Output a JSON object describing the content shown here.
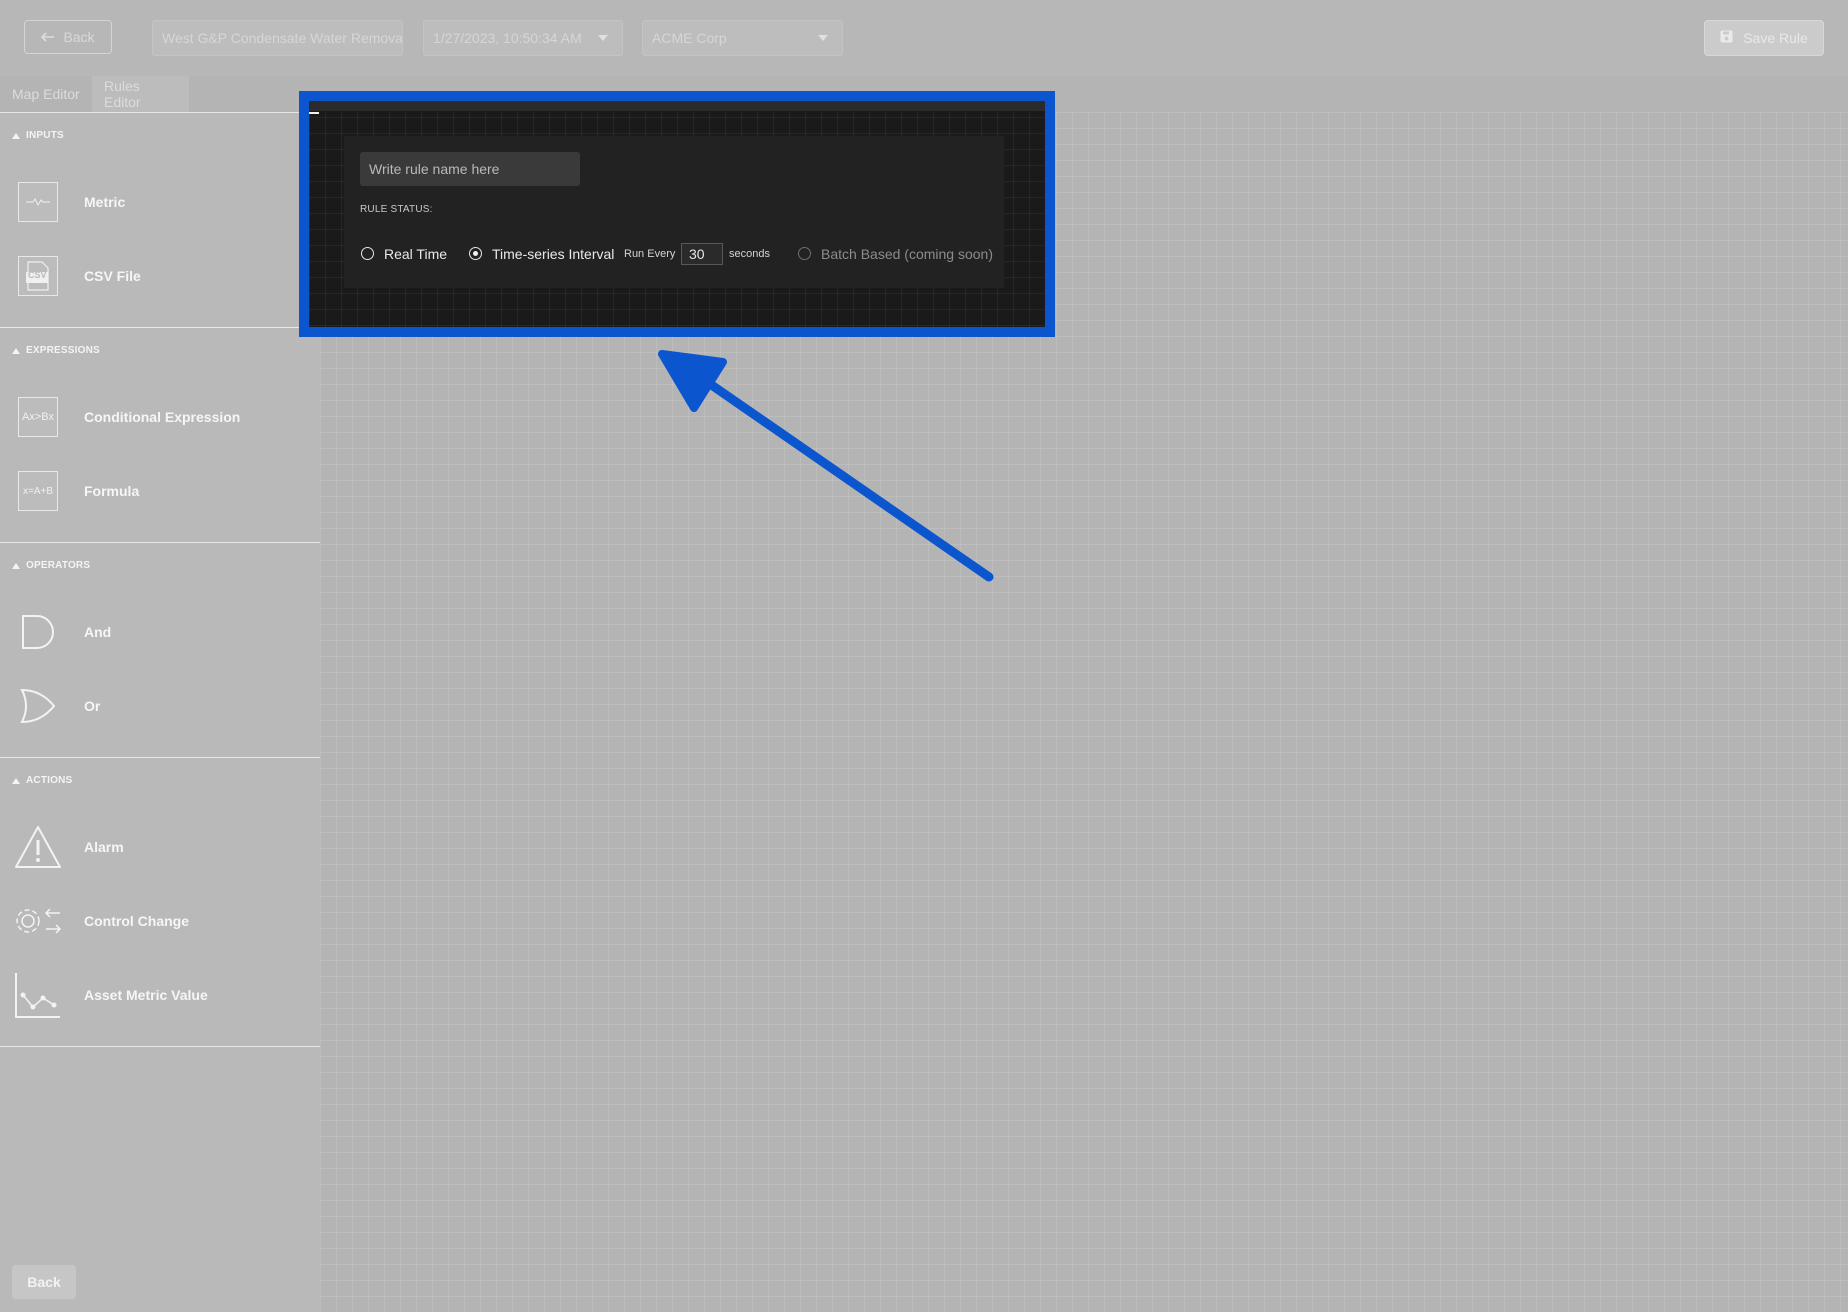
{
  "topbar": {
    "back_label": "Back",
    "asset_name": "West G&P Condensate Water Remova",
    "datetime": "1/27/2023, 10:50:34 AM",
    "company": "ACME Corp",
    "save_label": "Save Rule"
  },
  "tabs": [
    {
      "label": "Map Editor"
    },
    {
      "label": "Rules Editor"
    }
  ],
  "sidebar": {
    "sections": [
      {
        "title": "INPUTS",
        "items": [
          {
            "label": "Metric",
            "icon": "metric-icon"
          },
          {
            "label": "CSV File",
            "icon": "csv-file-icon"
          }
        ]
      },
      {
        "title": "EXPRESSIONS",
        "items": [
          {
            "label": "Conditional Expression",
            "icon": "conditional-expression-icon",
            "icon_text": "Ax>Bx"
          },
          {
            "label": "Formula",
            "icon": "formula-icon",
            "icon_text": "x=A+B"
          }
        ]
      },
      {
        "title": "OPERATORS",
        "items": [
          {
            "label": "And",
            "icon": "and-gate-icon"
          },
          {
            "label": "Or",
            "icon": "or-gate-icon"
          }
        ]
      },
      {
        "title": "ACTIONS",
        "items": [
          {
            "label": "Alarm",
            "icon": "alarm-warning-icon"
          },
          {
            "label": "Control Change",
            "icon": "control-change-icon"
          },
          {
            "label": "Asset Metric Value",
            "icon": "asset-metric-value-icon"
          }
        ]
      }
    ],
    "back_label": "Back",
    "csv_icon_text": "CSV"
  },
  "rule_panel": {
    "name_placeholder": "Write rule name here",
    "status_label": "RULE STATUS:",
    "options": {
      "real_time": "Real Time",
      "time_series": "Time-series Interval",
      "batch": "Batch Based (coming soon)"
    },
    "selected": "time_series",
    "run_every_label": "Run Every",
    "interval_value": "30",
    "interval_unit": "seconds"
  },
  "colors": {
    "highlight": "#0b55cf",
    "panel_bg": "#222222"
  }
}
